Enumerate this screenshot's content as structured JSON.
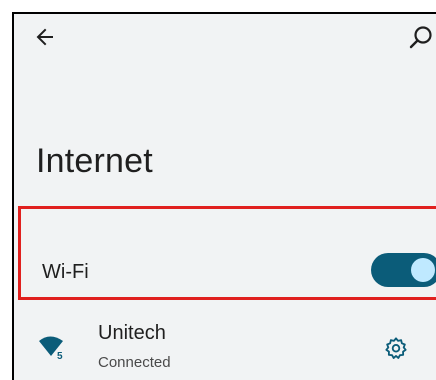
{
  "header": {
    "back_icon": "arrow-left-icon",
    "search_icon": "search-icon"
  },
  "page": {
    "title": "Internet"
  },
  "wifi": {
    "label": "Wi-Fi",
    "enabled": true,
    "highlight_color": "#e0201e",
    "toggle_color": "#0b5c79",
    "thumb_color": "#bfe9ff"
  },
  "network": {
    "name": "Unitech",
    "status": "Connected",
    "signal_badge": "5",
    "settings_icon": "gear-icon"
  }
}
